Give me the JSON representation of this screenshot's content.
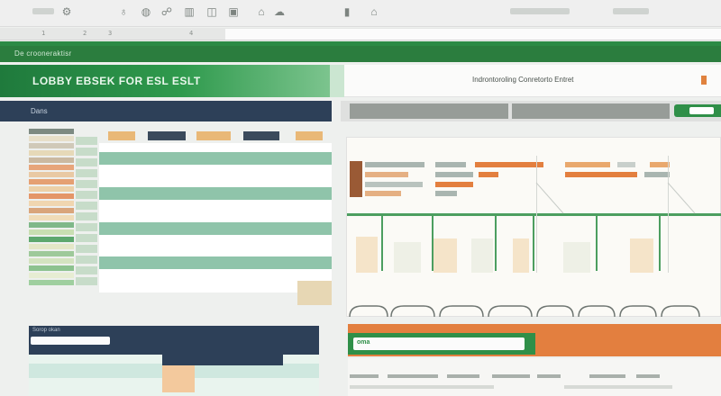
{
  "file_bar": {
    "label": "De crooneraktisr"
  },
  "banner": {
    "title": "LOBBY EBSEK FOR ESL ESLT"
  },
  "right_header": {
    "title": "Indrontoroling Conretorto Entret"
  },
  "navy_bar": {
    "label": "Dans"
  },
  "ruler": {
    "ticks": [
      "1",
      "2",
      "3",
      "4"
    ]
  },
  "bottom_left": {
    "input_label": "Sorop okan"
  },
  "bottom_right": {
    "input_value": "oma"
  },
  "toolbar": {
    "icons": [
      "settings-icon",
      "gift-icon",
      "globe-icon",
      "pin-icon",
      "fire-icon",
      "shield-icon",
      "cup-icon",
      "home-icon",
      "cloud-icon",
      "bell-icon"
    ]
  },
  "colors": {
    "primary_green": "#2b7d3e",
    "navy": "#2d4058",
    "orange": "#e37f3f",
    "teal": "#8fc4aa",
    "peach": "#f3c99d"
  }
}
